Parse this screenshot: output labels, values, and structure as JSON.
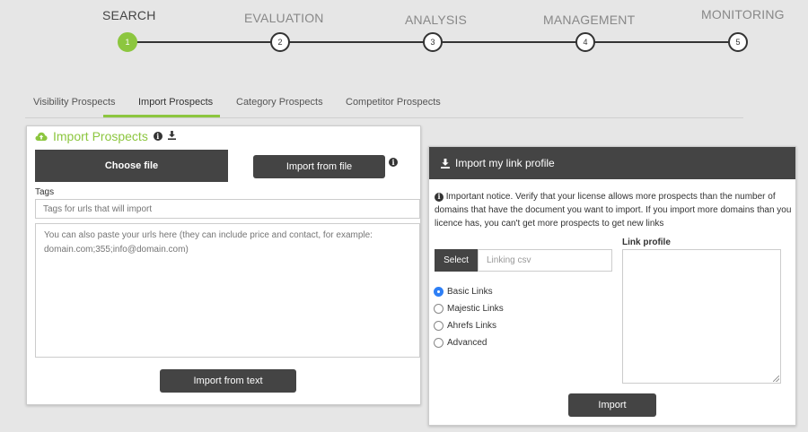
{
  "stepper": {
    "steps": [
      {
        "label": "SEARCH",
        "number": "1",
        "active": true
      },
      {
        "label": "EVALUATION",
        "number": "2",
        "active": false
      },
      {
        "label": "ANALYSIS",
        "number": "3",
        "active": false
      },
      {
        "label": "MANAGEMENT",
        "number": "4",
        "active": false
      },
      {
        "label": "MONITORING",
        "number": "5",
        "active": false
      }
    ]
  },
  "tabs": [
    {
      "label": "Visibility Prospects",
      "active": false
    },
    {
      "label": "Import Prospects",
      "active": true
    },
    {
      "label": "Category Prospects",
      "active": false
    },
    {
      "label": "Competitor Prospects",
      "active": false
    }
  ],
  "left_panel": {
    "title": "Import Prospects",
    "choose_file_label": "Choose file",
    "import_file_label": "Import from file",
    "tags_label": "Tags",
    "tags_placeholder": "Tags for urls that will import",
    "urls_placeholder": "You can also paste your urls here (they can include price and contact, for example: domain.com;355;info@domain.com)",
    "import_text_label": "Import from text"
  },
  "right_panel": {
    "title": "Import my link profile",
    "notice": "Important notice. Verify that your license allows more prospects than the number of domains that have the document you want to import. If you import more domains than you licence has, you can't get more prospects to get new links",
    "select_label": "Select",
    "csv_placeholder": "Linking csv",
    "link_types": [
      {
        "label": "Basic Links",
        "checked": true
      },
      {
        "label": "Majestic Links",
        "checked": false
      },
      {
        "label": "Ahrefs Links",
        "checked": false
      },
      {
        "label": "Advanced",
        "checked": false
      }
    ],
    "link_profile_label": "Link profile",
    "import_label": "Import"
  },
  "colors": {
    "accent": "#8cc63f",
    "dark": "#444444",
    "radio": "#2e7ff5"
  }
}
